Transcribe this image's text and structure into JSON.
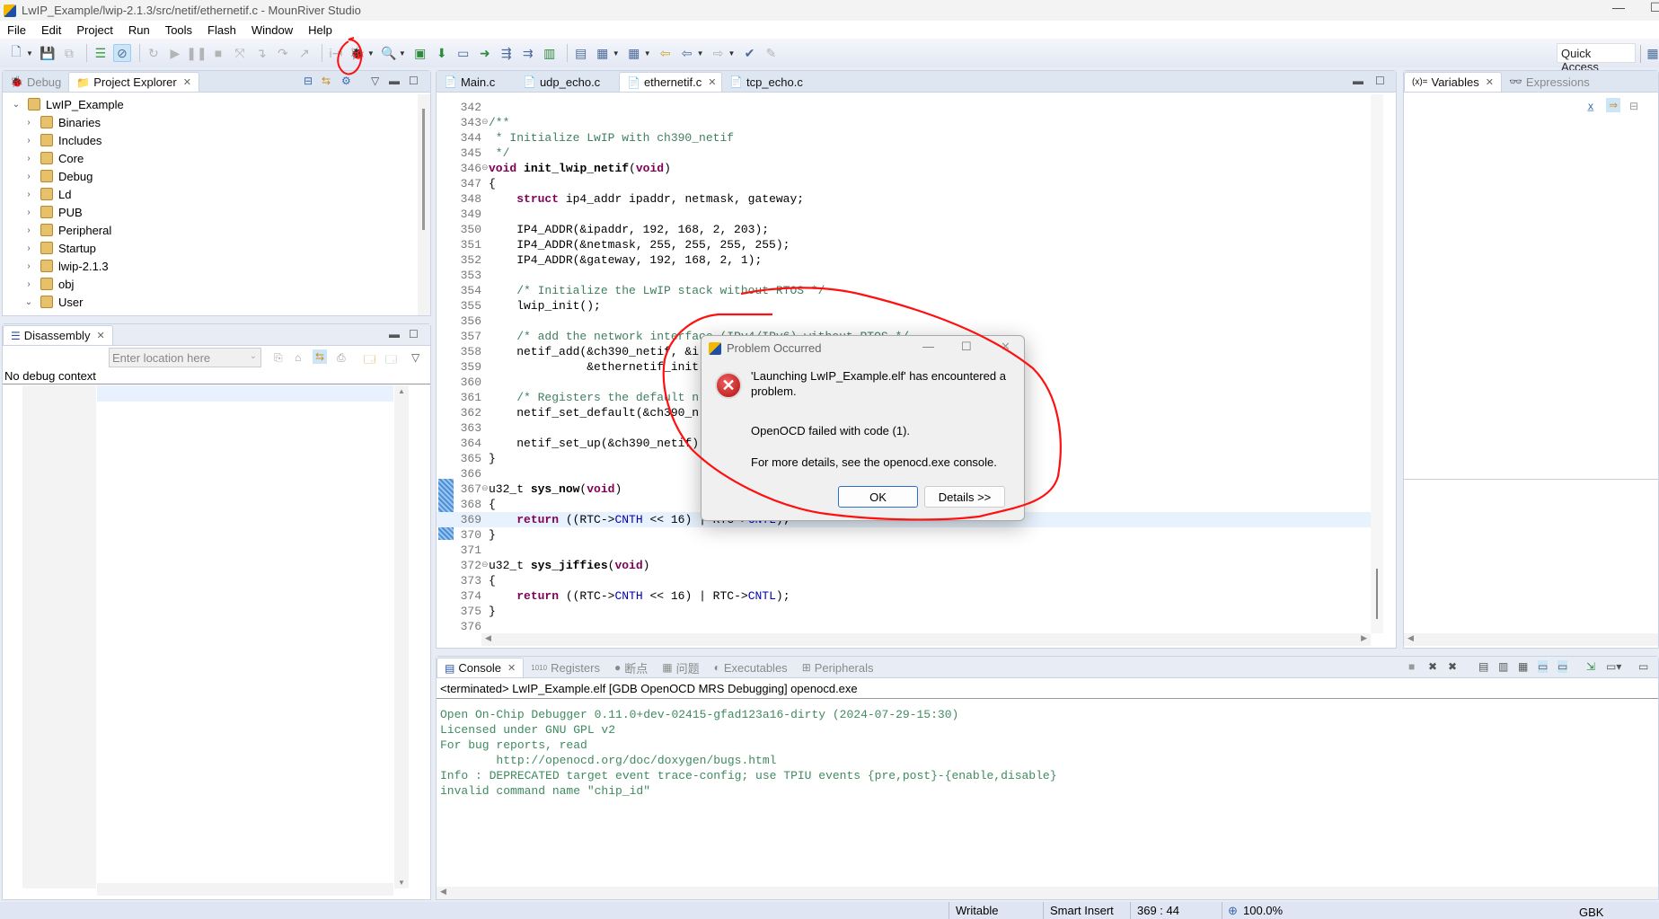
{
  "window": {
    "title": "LwIP_Example/lwip-2.1.3/src/netif/ethernetif.c - MounRiver Studio"
  },
  "menu": [
    "File",
    "Edit",
    "Project",
    "Run",
    "Tools",
    "Flash",
    "Window",
    "Help"
  ],
  "toolbar": {
    "quick_access": "Quick Access",
    "icons": [
      "new-icon",
      "save-icon",
      "save-all-icon",
      "layers-icon",
      "skip-breakpoints-icon",
      "relaunch-icon",
      "resume-icon",
      "suspend-icon",
      "terminate-icon",
      "disconnect-icon",
      "step-into-icon",
      "step-over-icon",
      "step-return-icon",
      "instruction-step-icon",
      "debug-icon",
      "search-icon",
      "build-icon",
      "download-icon",
      "terminal-icon"
    ]
  },
  "left_top": {
    "tabs": [
      {
        "label": "Debug",
        "active": false
      },
      {
        "label": "Project Explorer",
        "active": true
      }
    ],
    "tree": [
      {
        "label": "LwIP_Example",
        "expanded": true,
        "level": 0
      },
      {
        "label": "Binaries",
        "level": 1
      },
      {
        "label": "Includes",
        "level": 1
      },
      {
        "label": "Core",
        "level": 1
      },
      {
        "label": "Debug",
        "level": 1
      },
      {
        "label": "Ld",
        "level": 1
      },
      {
        "label": "PUB",
        "level": 1
      },
      {
        "label": "Peripheral",
        "level": 1
      },
      {
        "label": "Startup",
        "level": 1
      },
      {
        "label": "lwip-2.1.3",
        "level": 1
      },
      {
        "label": "obj",
        "level": 1
      },
      {
        "label": "User",
        "expanded": true,
        "level": 1
      }
    ]
  },
  "disassembly": {
    "tab": "Disassembly",
    "location_placeholder": "Enter location here",
    "status": "No debug context"
  },
  "editor": {
    "tabs": [
      {
        "label": "Main.c",
        "active": false
      },
      {
        "label": "udp_echo.c",
        "active": false
      },
      {
        "label": "ethernetif.c",
        "active": true
      },
      {
        "label": "tcp_echo.c",
        "active": false
      }
    ],
    "current_line": 369,
    "lines": [
      {
        "n": "342",
        "s": []
      },
      {
        "n": "343",
        "fold": true,
        "s": [
          [
            "/**",
            "cm"
          ]
        ]
      },
      {
        "n": "344",
        "s": [
          [
            " * Initialize LwIP with ch390_netif",
            "cm"
          ]
        ]
      },
      {
        "n": "345",
        "s": [
          [
            " */",
            "cm"
          ]
        ]
      },
      {
        "n": "346",
        "fold": true,
        "s": [
          [
            "void",
            "kw"
          ],
          [
            " "
          ],
          [
            "init_lwip_netif",
            "fn"
          ],
          [
            "("
          ],
          [
            "void",
            "kw"
          ],
          [
            ")"
          ]
        ]
      },
      {
        "n": "347",
        "s": [
          [
            "{"
          ]
        ]
      },
      {
        "n": "348",
        "s": [
          [
            "    "
          ],
          [
            "struct",
            "kw"
          ],
          [
            " ip4_addr ipaddr, netmask, gateway;"
          ]
        ]
      },
      {
        "n": "349",
        "s": []
      },
      {
        "n": "350",
        "s": [
          [
            "    IP4_ADDR(&ipaddr, 192, 168, 2, 203);"
          ]
        ]
      },
      {
        "n": "351",
        "s": [
          [
            "    IP4_ADDR(&netmask, 255, 255, 255, 255);"
          ]
        ]
      },
      {
        "n": "352",
        "s": [
          [
            "    IP4_ADDR(&gateway, 192, 168, 2, 1);"
          ]
        ]
      },
      {
        "n": "353",
        "s": []
      },
      {
        "n": "354",
        "s": [
          [
            "    "
          ],
          [
            "/* Initialize the LwIP stack without RTOS */",
            "cm"
          ]
        ]
      },
      {
        "n": "355",
        "s": [
          [
            "    lwip_init();"
          ]
        ]
      },
      {
        "n": "356",
        "s": []
      },
      {
        "n": "357",
        "s": [
          [
            "    "
          ],
          [
            "/* add the network interface (IPv4/IPv6) without RTOS */",
            "cm"
          ]
        ]
      },
      {
        "n": "358",
        "s": [
          [
            "    netif_add(&ch390_netif, &i"
          ]
        ]
      },
      {
        "n": "359",
        "s": [
          [
            "              &ethernetif_init"
          ]
        ]
      },
      {
        "n": "360",
        "s": []
      },
      {
        "n": "361",
        "s": [
          [
            "    "
          ],
          [
            "/* Registers the default n",
            "cm"
          ]
        ]
      },
      {
        "n": "362",
        "s": [
          [
            "    netif_set_default(&ch390_n"
          ]
        ]
      },
      {
        "n": "363",
        "s": []
      },
      {
        "n": "364",
        "s": [
          [
            "    netif_set_up(&ch390_netif)"
          ]
        ]
      },
      {
        "n": "365",
        "s": [
          [
            "}"
          ]
        ]
      },
      {
        "n": "366",
        "s": []
      },
      {
        "n": "367",
        "fold": true,
        "s": [
          [
            "u32_t "
          ],
          [
            "sys_now",
            "fn"
          ],
          [
            "("
          ],
          [
            "void",
            "kw"
          ],
          [
            ")"
          ]
        ]
      },
      {
        "n": "368",
        "s": [
          [
            "{"
          ]
        ]
      },
      {
        "n": "369",
        "s": [
          [
            "    "
          ],
          [
            "return",
            "kw"
          ],
          [
            " ((RTC->"
          ],
          [
            "CNTH",
            "fd"
          ],
          [
            " << 16) | RTC->"
          ],
          [
            "CNTL",
            "fd"
          ],
          [
            ");"
          ]
        ]
      },
      {
        "n": "370",
        "s": [
          [
            "}"
          ]
        ]
      },
      {
        "n": "371",
        "s": []
      },
      {
        "n": "372",
        "fold": true,
        "s": [
          [
            "u32_t "
          ],
          [
            "sys_jiffies",
            "fn"
          ],
          [
            "("
          ],
          [
            "void",
            "kw"
          ],
          [
            ")"
          ]
        ]
      },
      {
        "n": "373",
        "s": [
          [
            "{"
          ]
        ]
      },
      {
        "n": "374",
        "s": [
          [
            "    "
          ],
          [
            "return",
            "kw"
          ],
          [
            " ((RTC->"
          ],
          [
            "CNTH",
            "fd"
          ],
          [
            " << 16) | RTC->"
          ],
          [
            "CNTL",
            "fd"
          ],
          [
            ");"
          ]
        ]
      },
      {
        "n": "375",
        "s": [
          [
            "}"
          ]
        ]
      },
      {
        "n": "376",
        "s": []
      }
    ]
  },
  "right": {
    "tabs": [
      {
        "label": "Variables",
        "active": true
      },
      {
        "label": "Expressions",
        "active": false
      }
    ]
  },
  "console": {
    "tabs": [
      {
        "label": "Console",
        "active": true
      },
      {
        "label": "Registers"
      },
      {
        "label": "断点"
      },
      {
        "label": "问题"
      },
      {
        "label": "Executables"
      },
      {
        "label": "Peripherals"
      }
    ],
    "header": "<terminated> LwIP_Example.elf [GDB OpenOCD MRS Debugging] openocd.exe",
    "lines": [
      "Open On-Chip Debugger 0.11.0+dev-02415-gfad123a16-dirty (2024-07-29-15:30)",
      "Licensed under GNU GPL v2",
      "For bug reports, read",
      "        http://openocd.org/doc/doxygen/bugs.html",
      "Info : DEPRECATED target event trace-config; use TPIU events {pre,post}-{enable,disable}",
      "invalid command name \"chip_id\""
    ]
  },
  "dialog": {
    "title": "Problem Occurred",
    "message": "'Launching LwIP_Example.elf' has encountered a problem.",
    "detail": "OpenOCD failed with code (1).",
    "hint": "For more details, see the openocd.exe console.",
    "ok": "OK",
    "details": "Details >>"
  },
  "statusbar": {
    "writable": "Writable",
    "insert_mode": "Smart Insert",
    "position": "369 : 44",
    "zoom": "100.0%",
    "encoding": "GBK"
  },
  "colors": {
    "annotation": "#ff0000",
    "keyword": "#7f0055",
    "comment": "#3f7f5f",
    "field": "#0000c0",
    "console": "#3f8a5f"
  }
}
